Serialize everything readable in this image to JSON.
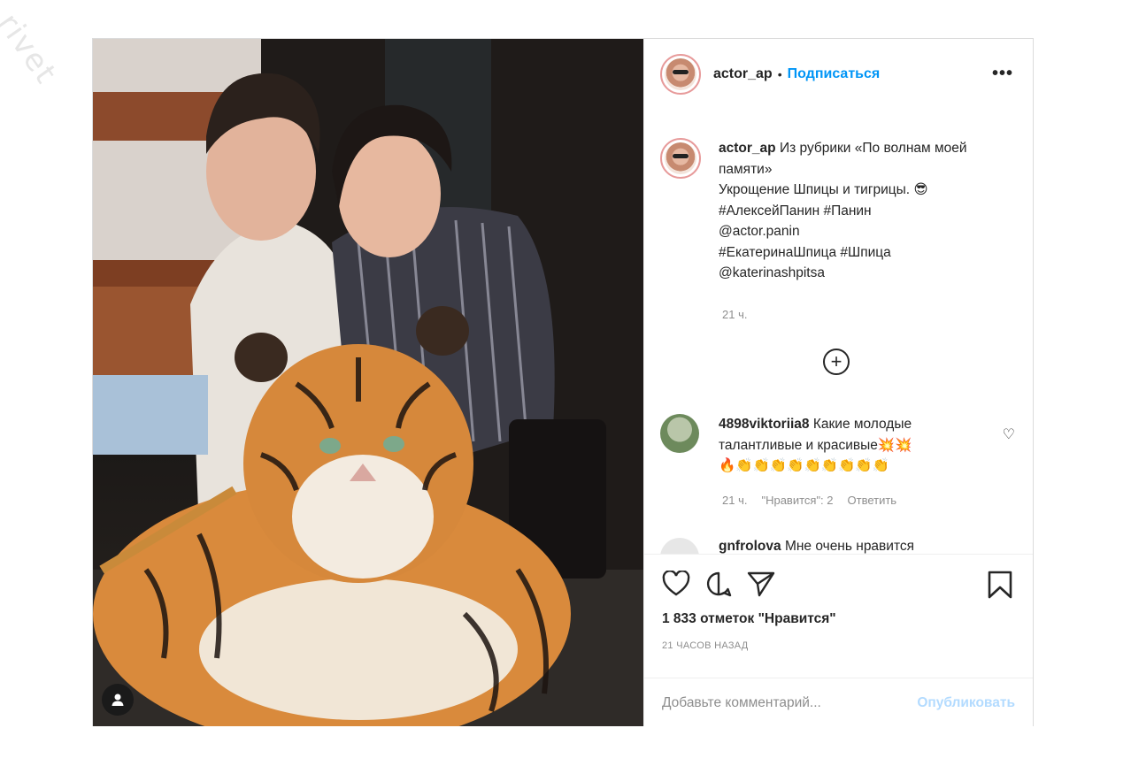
{
  "watermark": "rivet",
  "post": {
    "username": "actor_ap",
    "dot": "•",
    "follow_label": "Подписаться",
    "more_label": "•••",
    "caption": {
      "username": "actor_ap",
      "lines": [
        "Из рубрики «По волнам моей памяти»",
        "Укрощение Шпицы и тигрицы. 😎",
        "#АлексейПанин #Панин",
        "@actor.panin",
        "#ЕкатеринаШпица #Шпица",
        "@katerinashpitsa"
      ],
      "time": "21 ч."
    },
    "load_more_label": "+",
    "comments": [
      {
        "username": "4898viktoriia8",
        "text": "Какие молодые талантливые и красивые💥💥",
        "emoji_line": "🔥👏👏👏👏👏👏👏👏👏",
        "time": "21 ч.",
        "likes": "\"Нравится\": 2",
        "reply": "Ответить"
      },
      {
        "username": "gnfrolova",
        "text": "Мне очень нравится"
      }
    ],
    "likes_count": "1 833 отметок \"Нравится\"",
    "timestamp": "21 ЧАСОВ НАЗАД",
    "comment_placeholder": "Добавьте комментарий...",
    "publish_label": "Опубликовать"
  },
  "icons": {
    "heart": "heart-icon",
    "comment": "comment-icon",
    "share": "share-icon",
    "bookmark": "bookmark-icon",
    "tag": "user-tag-icon"
  },
  "colors": {
    "link": "#0095f6",
    "muted": "#8e8e8e",
    "publish_disabled": "#b3dbff"
  }
}
